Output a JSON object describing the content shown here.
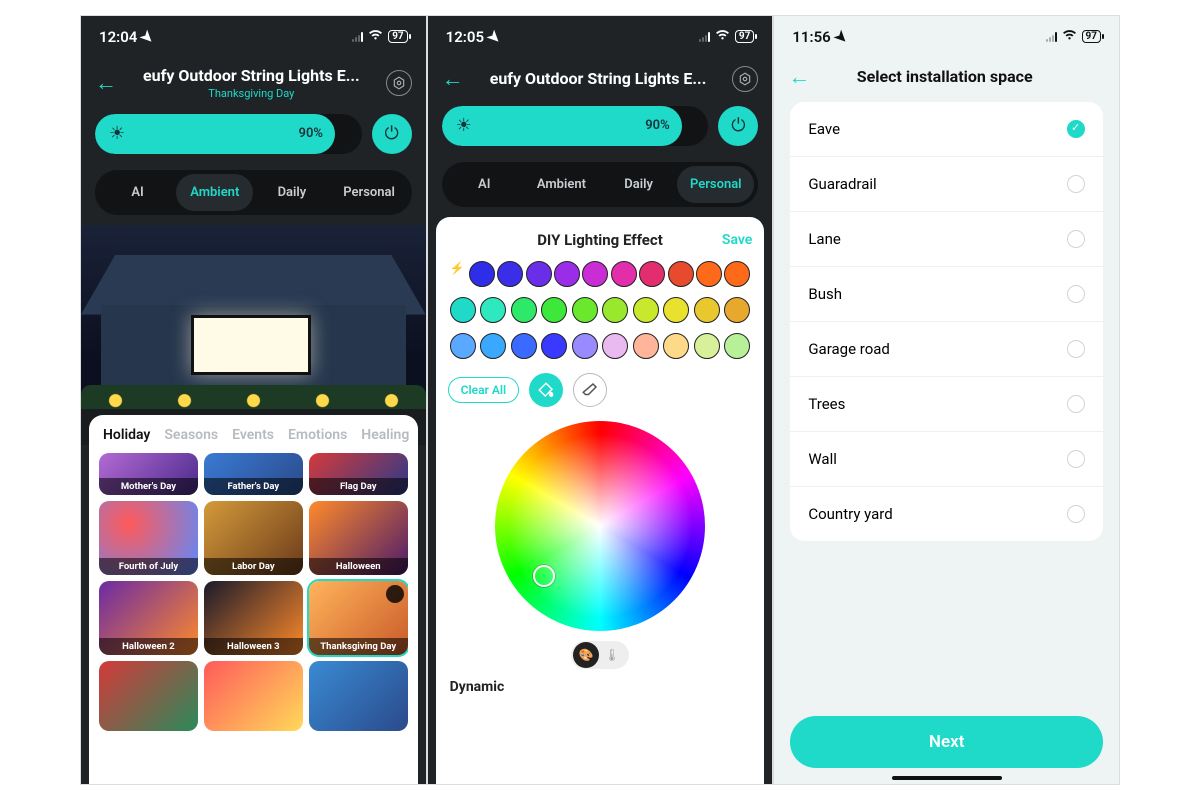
{
  "screens": {
    "s1": {
      "time": "12:04",
      "battery": "97",
      "title": "eufy Outdoor String Lights E...",
      "subtitle": "Thanksgiving Day",
      "brightness_pct": "90%",
      "mode_tabs": [
        "AI",
        "Ambient",
        "Daily",
        "Personal"
      ],
      "active_mode_index": 1,
      "preset_categories": [
        "Holiday",
        "Seasons",
        "Events",
        "Emotions",
        "Healing"
      ],
      "active_cat_index": 0,
      "presets_row0": [
        "Mother's Day",
        "Father's Day",
        "Flag Day"
      ],
      "presets_row1": [
        "Fourth of July",
        "Labor Day",
        "Halloween"
      ],
      "presets_row2": [
        "Halloween 2",
        "Halloween 3",
        "Thanksgiving Day"
      ],
      "selected_preset": "Thanksgiving Day"
    },
    "s2": {
      "time": "12:05",
      "battery": "97",
      "title": "eufy Outdoor String Lights E...",
      "brightness_pct": "90%",
      "mode_tabs": [
        "AI",
        "Ambient",
        "Daily",
        "Personal"
      ],
      "active_mode_index": 3,
      "diy_title": "DIY Lighting Effect",
      "save_label": "Save",
      "clear_label": "Clear All",
      "dynamic_label": "Dynamic",
      "dot_colors": {
        "row1": [
          "#2e2ee8",
          "#3a2ee8",
          "#6a2ee8",
          "#9a2ee8",
          "#c82ed4",
          "#e22eaa",
          "#e22e6e",
          "#e84a2e",
          "#ff6a1a",
          "#ff6a1a"
        ],
        "row2": [
          "#1fd9c9",
          "#2ee8c0",
          "#2ee86a",
          "#3ee83a",
          "#6ae82e",
          "#9ae82e",
          "#c8e82e",
          "#e8e22e",
          "#e8c82e",
          "#e8a82e"
        ],
        "row3": [
          "#5aa8ff",
          "#3aa8ff",
          "#3a6aff",
          "#3a3aff",
          "#9a8aff",
          "#e8baf0",
          "#ffb59a",
          "#ffd98a",
          "#d8f09a",
          "#b8f09a"
        ]
      }
    },
    "s3": {
      "time": "11:56",
      "battery": "97",
      "title": "Select installation space",
      "options": [
        "Eave",
        "Guaradrail",
        "Lane",
        "Bush",
        "Garage road",
        "Trees",
        "Wall",
        "Country yard"
      ],
      "selected_index": 0,
      "next_label": "Next"
    }
  },
  "colors": {
    "accent": "#1fd9c9"
  }
}
